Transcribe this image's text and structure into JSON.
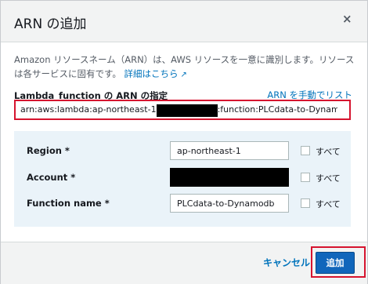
{
  "dialog": {
    "title": "ARN の追加",
    "close_glyph": "×"
  },
  "description": {
    "text": "Amazon リソースネーム（ARN）は、AWS リソースを一意に識別します。リソースは各サービスに固有です。",
    "link_label": "詳細はこちら",
    "link_icon": "external-link-icon"
  },
  "arn_field": {
    "label": "Lambda_function の ARN の指定",
    "manual_link": "ARN を手動でリスト",
    "value_prefix": "arn:aws:lambda:ap-northeast-1",
    "value_suffix": ":function:PLCdata-to-Dynamodb"
  },
  "rows": [
    {
      "label": "Region *",
      "value": "ap-northeast-1",
      "all_label": "すべて"
    },
    {
      "label": "Account *",
      "value": "",
      "all_label": "すべて"
    },
    {
      "label": "Function name *",
      "value": "PLCdata-to-Dynamodb",
      "all_label": "すべて"
    }
  ],
  "footer": {
    "cancel_label": "キャンセル",
    "add_label": "追加"
  },
  "colors": {
    "link": "#0073bb",
    "primary_button": "#1166bb",
    "highlight_outline": "#d6142f",
    "panel_bg": "#eaf3f9"
  }
}
